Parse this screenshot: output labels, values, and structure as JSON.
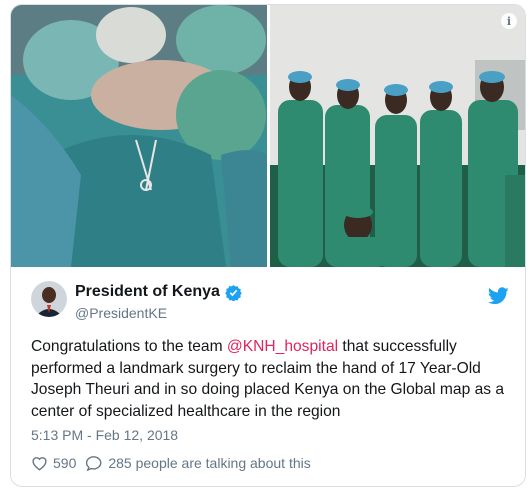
{
  "tweet": {
    "display_name": "President of Kenya",
    "handle": "@PresidentKE",
    "text_before": "Congratulations to the team ",
    "mention": "@KNH_hospital",
    "text_after": " that successfully performed a landmark surgery to reclaim the hand of 17 Year-Old Joseph Theuri and in so doing placed Kenya on the Global map as a center  of specialized healthcare in the region",
    "timestamp": "5:13 PM - Feb 12, 2018",
    "like_count": "590",
    "talking_text": "285 people are talking about this"
  },
  "media": {
    "info_label": "i"
  },
  "colors": {
    "mention": "#e0245e",
    "verified": "#1da1f2",
    "twitter_brand": "#1da1f2",
    "secondary_text": "#657786",
    "scrub_green": "#2e8b6f",
    "scrub_teal": "#3f9fa8"
  },
  "icons": [
    "info-icon",
    "verified-badge-icon",
    "twitter-bird-icon",
    "heart-icon",
    "comment-bubble-icon"
  ]
}
